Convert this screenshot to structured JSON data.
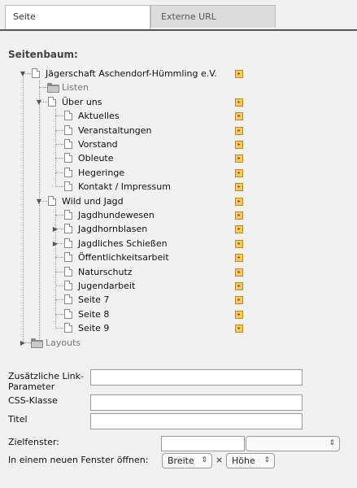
{
  "tabs": [
    {
      "label": "Seite",
      "active": true
    },
    {
      "label": "Externe URL",
      "active": false
    }
  ],
  "tree_heading": "Seitenbaum:",
  "tree": [
    {
      "label": "Jägerschaft Aschendorf-Hümmling e.V.",
      "icon": "page-icon",
      "twisty": "expanded",
      "action": true
    },
    {
      "label": "Listen",
      "icon": "folder-icon",
      "twisty": "none",
      "action": false,
      "muted": true
    },
    {
      "label": "Über uns",
      "icon": "page-icon",
      "twisty": "expanded",
      "action": true
    },
    {
      "label": "Aktuelles",
      "icon": "page-icon",
      "twisty": "none",
      "action": true
    },
    {
      "label": "Veranstaltungen",
      "icon": "page-icon",
      "twisty": "none",
      "action": true
    },
    {
      "label": "Vorstand",
      "icon": "page-icon",
      "twisty": "none",
      "action": true
    },
    {
      "label": "Obleute",
      "icon": "page-icon",
      "twisty": "none",
      "action": true
    },
    {
      "label": "Hegeringe",
      "icon": "page-icon",
      "twisty": "none",
      "action": true
    },
    {
      "label": "Kontakt / Impressum",
      "icon": "page-icon",
      "twisty": "none",
      "action": true
    },
    {
      "label": "Wild und Jagd",
      "icon": "page-icon",
      "twisty": "expanded",
      "action": true
    },
    {
      "label": "Jagdhundewesen",
      "icon": "page-icon",
      "twisty": "none",
      "action": true
    },
    {
      "label": "Jagdhornblasen",
      "icon": "page-icon",
      "twisty": "collapsed",
      "action": true
    },
    {
      "label": "Jagdliches Schießen",
      "icon": "page-icon",
      "twisty": "collapsed",
      "action": true
    },
    {
      "label": "Öffentlichkeitsarbeit",
      "icon": "page-icon",
      "twisty": "none",
      "action": true
    },
    {
      "label": "Naturschutz",
      "icon": "page-icon",
      "twisty": "none",
      "action": true
    },
    {
      "label": "Jugendarbeit",
      "icon": "page-icon",
      "twisty": "none",
      "action": true
    },
    {
      "label": "Seite 7",
      "icon": "page-icon",
      "twisty": "none",
      "action": true
    },
    {
      "label": "Seite 8",
      "icon": "page-icon",
      "twisty": "none",
      "action": true
    },
    {
      "label": "Seite 9",
      "icon": "page-icon",
      "twisty": "none",
      "action": true
    },
    {
      "label": "Layouts",
      "icon": "folder-icon",
      "twisty": "collapsed",
      "action": false,
      "muted": true
    }
  ],
  "form": {
    "link_params_label": "Zusätzliche Link-Parameter",
    "link_params_value": "",
    "css_label": "CSS-Klasse",
    "css_value": "",
    "title_label": "Titel",
    "title_value": "",
    "target_label": "Zielfenster:",
    "target_value": "",
    "target_select": "",
    "popup_label": "In einem neuen Fenster öffnen:",
    "width_select": "Breite",
    "times": "×",
    "height_select": "Höhe"
  }
}
